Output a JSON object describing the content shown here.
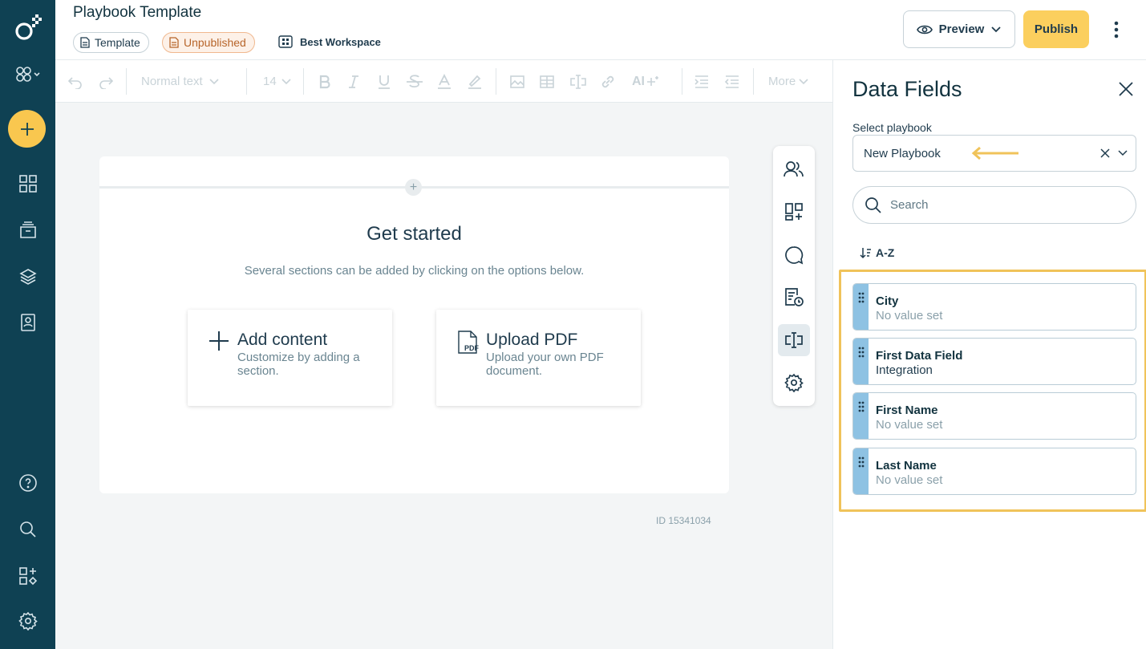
{
  "header": {
    "title": "Playbook Template",
    "template_chip": "Template",
    "status_chip": "Unpublished",
    "workspace": "Best Workspace",
    "preview_label": "Preview",
    "publish_label": "Publish"
  },
  "toolbar": {
    "text_style": "Normal text",
    "font_size": "14",
    "ai_label": "AI",
    "more_label": "More"
  },
  "canvas": {
    "heading": "Get started",
    "subheading": "Several sections can be added by clicking on the options below.",
    "add_card": {
      "title": "Add content",
      "description": "Customize by adding a section."
    },
    "pdf_card": {
      "title": "Upload PDF",
      "description": "Upload your own PDF document."
    },
    "doc_id": "ID 15341034"
  },
  "panel": {
    "title": "Data Fields",
    "select_label": "Select playbook",
    "select_value": "New Playbook",
    "search_placeholder": "Search",
    "sort_label": "A-Z",
    "fields": [
      {
        "name": "City",
        "value": "No value set"
      },
      {
        "name": "First Data Field",
        "value": "Integration"
      },
      {
        "name": "First Name",
        "value": "No value set"
      },
      {
        "name": "Last Name",
        "value": "No value set"
      }
    ]
  },
  "colors": {
    "rail": "#0f4153",
    "accent": "#f9c74f",
    "highlight": "#f0c35a",
    "field_handle": "#8ec2e3"
  }
}
